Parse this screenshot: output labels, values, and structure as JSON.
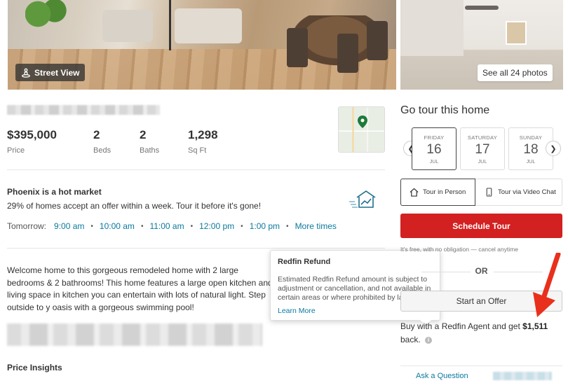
{
  "photos": {
    "street_view_label": "Street View",
    "see_all_label": "See all 24 photos"
  },
  "listing": {
    "price": "$395,000",
    "price_label": "Price",
    "beds": "2",
    "beds_label": "Beds",
    "baths": "2",
    "baths_label": "Baths",
    "sqft": "1,298",
    "sqft_label": "Sq Ft"
  },
  "market": {
    "title": "Phoenix is a hot market",
    "subtitle": "29% of homes accept an offer within a week. Tour it before it's gone!"
  },
  "tour_times": {
    "prefix": "Tomorrow:",
    "slots": [
      "9:00 am",
      "10:00 am",
      "11:00 am",
      "12:00 pm",
      "1:00 pm"
    ],
    "more_label": "More times"
  },
  "description": "Welcome home to this gorgeous remodeled home with 2 large bedrooms & 2 bathrooms! This home features a large open kitchen and living space in kitchen you can entertain with lots of natural light. Step outside to y oasis with a gorgeous swimming pool!",
  "price_insights_label": "Price Insights",
  "tooltip": {
    "title": "Redfin Refund",
    "body": "Estimated Redfin Refund amount is subject to adjustment or cancellation, and not available in certain areas or where prohibited by law.",
    "link": "Learn More"
  },
  "tour_panel": {
    "title": "Go tour this home",
    "days": [
      {
        "weekday": "FRIDAY",
        "day": "16",
        "month": "JUL",
        "selected": true
      },
      {
        "weekday": "SATURDAY",
        "day": "17",
        "month": "JUL",
        "selected": false
      },
      {
        "weekday": "SUNDAY",
        "day": "18",
        "month": "JUL",
        "selected": false
      }
    ],
    "in_person_label": "Tour in Person",
    "video_label": "Tour via Video Chat",
    "schedule_label": "Schedule Tour",
    "free_note": "It's free, with no obligation — cancel anytime",
    "or_label": "OR",
    "offer_label": "Start an Offer",
    "buy_prefix": "Buy with a Redfin Agent and get",
    "refund_amount": "$1,511",
    "buy_suffix": "back.",
    "ask_label": "Ask a Question"
  },
  "colors": {
    "accent_red": "#d32020",
    "link_blue": "#0b7a9e",
    "annotation_arrow": "#e8301c"
  }
}
